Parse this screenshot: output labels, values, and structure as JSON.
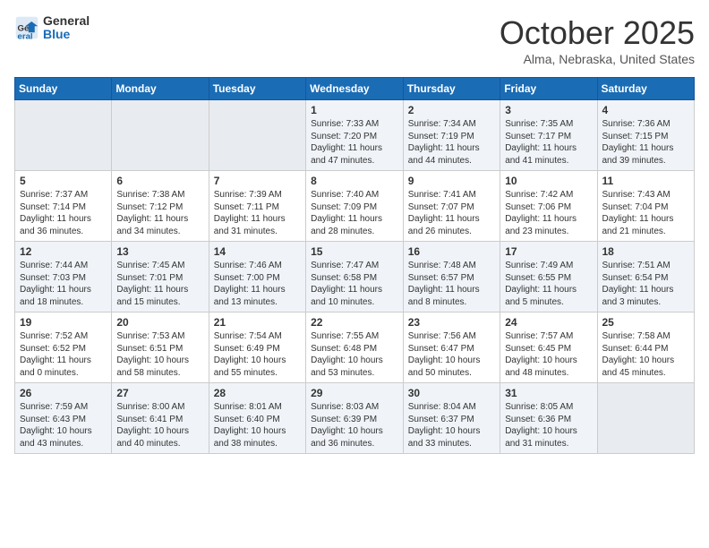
{
  "logo": {
    "general": "General",
    "blue": "Blue"
  },
  "title": "October 2025",
  "location": "Alma, Nebraska, United States",
  "days_of_week": [
    "Sunday",
    "Monday",
    "Tuesday",
    "Wednesday",
    "Thursday",
    "Friday",
    "Saturday"
  ],
  "weeks": [
    [
      {
        "day": "",
        "info": ""
      },
      {
        "day": "",
        "info": ""
      },
      {
        "day": "",
        "info": ""
      },
      {
        "day": "1",
        "info": "Sunrise: 7:33 AM\nSunset: 7:20 PM\nDaylight: 11 hours\nand 47 minutes."
      },
      {
        "day": "2",
        "info": "Sunrise: 7:34 AM\nSunset: 7:19 PM\nDaylight: 11 hours\nand 44 minutes."
      },
      {
        "day": "3",
        "info": "Sunrise: 7:35 AM\nSunset: 7:17 PM\nDaylight: 11 hours\nand 41 minutes."
      },
      {
        "day": "4",
        "info": "Sunrise: 7:36 AM\nSunset: 7:15 PM\nDaylight: 11 hours\nand 39 minutes."
      }
    ],
    [
      {
        "day": "5",
        "info": "Sunrise: 7:37 AM\nSunset: 7:14 PM\nDaylight: 11 hours\nand 36 minutes."
      },
      {
        "day": "6",
        "info": "Sunrise: 7:38 AM\nSunset: 7:12 PM\nDaylight: 11 hours\nand 34 minutes."
      },
      {
        "day": "7",
        "info": "Sunrise: 7:39 AM\nSunset: 7:11 PM\nDaylight: 11 hours\nand 31 minutes."
      },
      {
        "day": "8",
        "info": "Sunrise: 7:40 AM\nSunset: 7:09 PM\nDaylight: 11 hours\nand 28 minutes."
      },
      {
        "day": "9",
        "info": "Sunrise: 7:41 AM\nSunset: 7:07 PM\nDaylight: 11 hours\nand 26 minutes."
      },
      {
        "day": "10",
        "info": "Sunrise: 7:42 AM\nSunset: 7:06 PM\nDaylight: 11 hours\nand 23 minutes."
      },
      {
        "day": "11",
        "info": "Sunrise: 7:43 AM\nSunset: 7:04 PM\nDaylight: 11 hours\nand 21 minutes."
      }
    ],
    [
      {
        "day": "12",
        "info": "Sunrise: 7:44 AM\nSunset: 7:03 PM\nDaylight: 11 hours\nand 18 minutes."
      },
      {
        "day": "13",
        "info": "Sunrise: 7:45 AM\nSunset: 7:01 PM\nDaylight: 11 hours\nand 15 minutes."
      },
      {
        "day": "14",
        "info": "Sunrise: 7:46 AM\nSunset: 7:00 PM\nDaylight: 11 hours\nand 13 minutes."
      },
      {
        "day": "15",
        "info": "Sunrise: 7:47 AM\nSunset: 6:58 PM\nDaylight: 11 hours\nand 10 minutes."
      },
      {
        "day": "16",
        "info": "Sunrise: 7:48 AM\nSunset: 6:57 PM\nDaylight: 11 hours\nand 8 minutes."
      },
      {
        "day": "17",
        "info": "Sunrise: 7:49 AM\nSunset: 6:55 PM\nDaylight: 11 hours\nand 5 minutes."
      },
      {
        "day": "18",
        "info": "Sunrise: 7:51 AM\nSunset: 6:54 PM\nDaylight: 11 hours\nand 3 minutes."
      }
    ],
    [
      {
        "day": "19",
        "info": "Sunrise: 7:52 AM\nSunset: 6:52 PM\nDaylight: 11 hours\nand 0 minutes."
      },
      {
        "day": "20",
        "info": "Sunrise: 7:53 AM\nSunset: 6:51 PM\nDaylight: 10 hours\nand 58 minutes."
      },
      {
        "day": "21",
        "info": "Sunrise: 7:54 AM\nSunset: 6:49 PM\nDaylight: 10 hours\nand 55 minutes."
      },
      {
        "day": "22",
        "info": "Sunrise: 7:55 AM\nSunset: 6:48 PM\nDaylight: 10 hours\nand 53 minutes."
      },
      {
        "day": "23",
        "info": "Sunrise: 7:56 AM\nSunset: 6:47 PM\nDaylight: 10 hours\nand 50 minutes."
      },
      {
        "day": "24",
        "info": "Sunrise: 7:57 AM\nSunset: 6:45 PM\nDaylight: 10 hours\nand 48 minutes."
      },
      {
        "day": "25",
        "info": "Sunrise: 7:58 AM\nSunset: 6:44 PM\nDaylight: 10 hours\nand 45 minutes."
      }
    ],
    [
      {
        "day": "26",
        "info": "Sunrise: 7:59 AM\nSunset: 6:43 PM\nDaylight: 10 hours\nand 43 minutes."
      },
      {
        "day": "27",
        "info": "Sunrise: 8:00 AM\nSunset: 6:41 PM\nDaylight: 10 hours\nand 40 minutes."
      },
      {
        "day": "28",
        "info": "Sunrise: 8:01 AM\nSunset: 6:40 PM\nDaylight: 10 hours\nand 38 minutes."
      },
      {
        "day": "29",
        "info": "Sunrise: 8:03 AM\nSunset: 6:39 PM\nDaylight: 10 hours\nand 36 minutes."
      },
      {
        "day": "30",
        "info": "Sunrise: 8:04 AM\nSunset: 6:37 PM\nDaylight: 10 hours\nand 33 minutes."
      },
      {
        "day": "31",
        "info": "Sunrise: 8:05 AM\nSunset: 6:36 PM\nDaylight: 10 hours\nand 31 minutes."
      },
      {
        "day": "",
        "info": ""
      }
    ]
  ]
}
